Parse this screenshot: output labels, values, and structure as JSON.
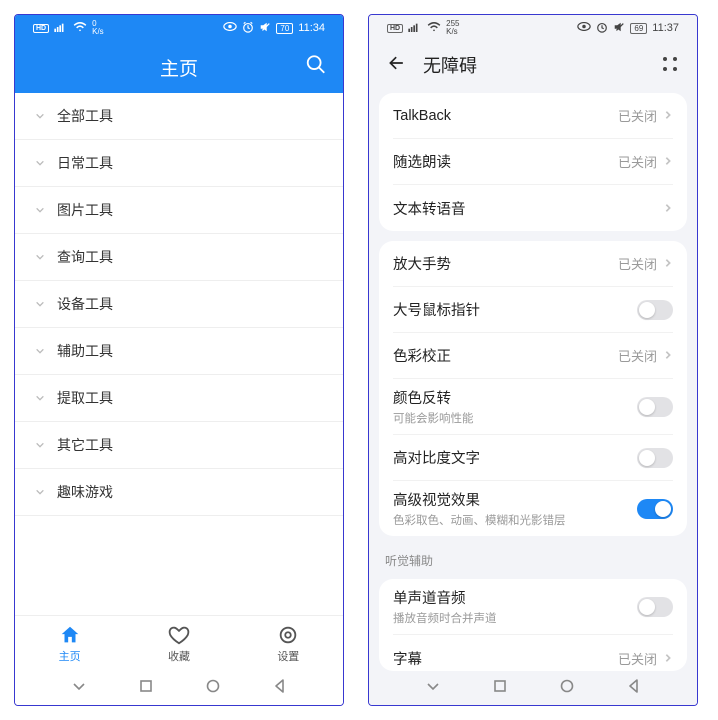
{
  "left": {
    "status": {
      "net": "0",
      "net_unit": "K/s",
      "time": "11:34"
    },
    "header": {
      "title": "主页"
    },
    "categories": [
      "全部工具",
      "日常工具",
      "图片工具",
      "查询工具",
      "设备工具",
      "辅助工具",
      "提取工具",
      "其它工具",
      "趣味游戏"
    ],
    "nav": {
      "home": "主页",
      "fav": "收藏",
      "settings": "设置"
    }
  },
  "right": {
    "status": {
      "net": "255",
      "net_unit": "K/s",
      "time": "11:37"
    },
    "header": {
      "title": "无障碍"
    },
    "status_closed": "已关闭",
    "group1": [
      {
        "label": "TalkBack",
        "trail": "status"
      },
      {
        "label": "随选朗读",
        "trail": "status"
      },
      {
        "label": "文本转语音",
        "trail": "chevron"
      }
    ],
    "group2": [
      {
        "label": "放大手势",
        "trail": "status"
      },
      {
        "label": "大号鼠标指针",
        "trail": "toggle-off"
      },
      {
        "label": "色彩校正",
        "trail": "status"
      },
      {
        "label": "颜色反转",
        "sub": "可能会影响性能",
        "trail": "toggle-off"
      },
      {
        "label": "高对比度文字",
        "trail": "toggle-off"
      },
      {
        "label": "高级视觉效果",
        "sub": "色彩取色、动画、模糊和光影错层",
        "trail": "toggle-on"
      }
    ],
    "section_audio": "听觉辅助",
    "group3": [
      {
        "label": "单声道音频",
        "sub": "播放音频时合并声道",
        "trail": "toggle-off"
      },
      {
        "label": "字幕",
        "trail": "status"
      }
    ]
  }
}
